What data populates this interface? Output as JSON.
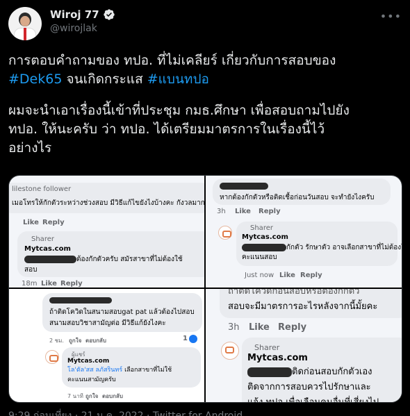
{
  "author": {
    "display_name": "Wiroj 77",
    "handle": "@wirojlak",
    "verified_icon": "verified-badge-icon",
    "more_icon": "more-icon"
  },
  "tweet": {
    "line1": "การตอบคำถามของ ทปอ. ที่ไม่เคลียร์ เกี่ยวกับการสอบของ",
    "hashtag1": "#Dek65",
    "mid_text": " จนเกิดกระแส ",
    "hashtag2": "#แบนทปอ",
    "para2_line1": "ผมจะนำเอาเรื่องนี้เข้าที่ประชุม กมธ.ศึกษา เพื่อสอบถามไปยัง",
    "para2_line2": "ทปอ. ให้นะครับ ว่า ทปอ. ได้เตรียมมาตรการในเรื่องนี้ไว้",
    "para2_line3": "อย่างไร"
  },
  "media": {
    "tile1": {
      "badge": "lilestone follower",
      "comment": "เมอโทรให้กักตัวระหว่างช่วงสอบ มีวิธีแก้ไขยังไงบ้างคะ  กังวลมาก",
      "like": "Like",
      "reply": "Reply",
      "sharer_label": "Sharer",
      "sharer_name": "Mytcas.com",
      "sharer_reply": "ต้องกักตัวครับ สมัรสาขาที่ไม่ต้องใช้",
      "sharer_reply_2": "สอบ",
      "time": "18m",
      "like2": "Like",
      "reply2": "Reply"
    },
    "tile2": {
      "comment": "หากต้องกักตัวหรือติดเชื้อก่อนวันสอบ จะทำยังไงครับ",
      "time": "3h",
      "like": "Like",
      "reply": "Reply",
      "sharer_label": "Sharer",
      "sharer_name": "Mytcas.com",
      "sharer_reply": "กักตัว รักษาตัว อาจเลือกสาขาที่ไม่ต้องใช้",
      "sharer_reply_2": "คะแนนสอบ",
      "time2": "Just now",
      "like2": "Like",
      "reply2": "Reply"
    },
    "tile3": {
      "comment_1": "ถ้าติดโควิดในสนามสอบgat pat แล้วต้องไปสอบ",
      "comment_2": "สนามสอบวิชาสามัญต่อ มีวิธีแก้ยังไงคะ",
      "time": "2 ชม.",
      "like": "ถูกใจ",
      "reply": "ตอบกลับ",
      "reaction_count": "1",
      "sharer_label": "ผู้แชร์",
      "sharer_name": "Mytcas.com",
      "mention": "โล'ตัล'สส ลภัสรินทร์",
      "sharer_reply": " เลือกสาขาที่ไม่ใช้",
      "sharer_reply_2": "คะแนนสามัญครับ",
      "time2": "7 นาที",
      "like2": "ถูกใจ",
      "reply2": "ตอบกลับ"
    },
    "tile4": {
      "comment_1": "ถ้าติดโควิดก่อนสอบหรือต้องกักตัว",
      "comment_2": "สอบจะมีมาตรการอะไรหลังจากนี้มั้ยคะ",
      "time": "3h",
      "like": "Like",
      "reply": "Reply",
      "sharer_label": "Sharer",
      "sharer_name": "Mytcas.com",
      "sharer_reply": "ติดก่อนสอบกักตัวเอง",
      "sharer_reply_2": "ติดจากการสอบควรไปรักษาและ",
      "sharer_reply_3": "แจ้ง ทปอ เพื่อเลือนคนอื่นที่เสี่ยงไป"
    }
  },
  "footer": {
    "timestamp": "9:29 ก่อนเที่ยง · 21 ม.ค. 2022 · Twitter for Android"
  }
}
